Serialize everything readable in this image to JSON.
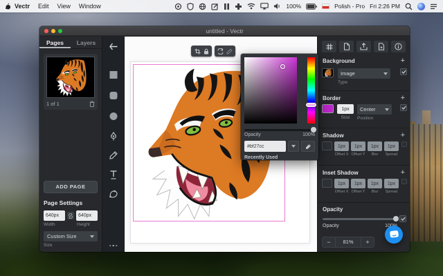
{
  "colors": {
    "accent": "#bf27cc",
    "selection": "#e879d2",
    "chat": "#1d8ff0",
    "traffic_red": "#ff5f57",
    "traffic_yellow": "#febc2e",
    "traffic_green": "#28c840"
  },
  "menubar": {
    "menus": [
      "Vectr",
      "Edit",
      "View",
      "Window"
    ],
    "battery": "100%",
    "input_source": "Polish - Pro",
    "clock": "Fri 2:26 PM",
    "status_icon_names": [
      "app-swirl-icon",
      "shield-icon",
      "globe-icon",
      "compose-icon",
      "columns-icon",
      "plus-icon",
      "wifi-icon",
      "airplay-icon",
      "volume-icon",
      "battery-icon",
      "input-flag-icon",
      "spotlight-icon",
      "siri-icon",
      "notification-center-icon"
    ]
  },
  "window": {
    "title": "untitled - Vectr"
  },
  "sidebar": {
    "tab_pages": "Pages",
    "tab_layers": "Layers",
    "page_indicator": "1 of 1",
    "add_page": "ADD PAGE",
    "settings_title": "Page Settings",
    "width_value": "640px",
    "width_label": "Width",
    "height_value": "640px",
    "height_label": "Height",
    "size_value": "Custom Size",
    "size_label": "Size"
  },
  "tools": [
    "back",
    "rectangle",
    "rounded-rectangle",
    "ellipse",
    "pen",
    "pencil",
    "text",
    "shape",
    "more"
  ],
  "picker": {
    "opacity_label": "Opacity",
    "opacity_value": "100%",
    "hex_value": "#bf27cc",
    "recently_used": "Recently Used"
  },
  "inspector": {
    "top_icon_names": [
      "grid-icon",
      "duplicate-icon",
      "export-icon",
      "import-icon",
      "info-icon"
    ],
    "add_symbol": "+",
    "background_title": "Background",
    "background_type_value": "Image",
    "background_type_label": "Type",
    "border_title": "Border",
    "border_size_value": "1px",
    "border_size_label": "Size",
    "border_position_value": "Center",
    "border_position_label": "Position",
    "shadow_title": "Shadow",
    "shadow_fields": [
      {
        "value": "1px",
        "label": "Offset X"
      },
      {
        "value": "1px",
        "label": "Offset Y"
      },
      {
        "value": "1px",
        "label": "Blur"
      },
      {
        "value": "1px",
        "label": "Spread"
      }
    ],
    "inset_title": "Inset Shadow",
    "inset_fields": [
      {
        "value": "1px",
        "label": "Offset X"
      },
      {
        "value": "1px",
        "label": "Offset Y"
      },
      {
        "value": "1px",
        "label": "Blur"
      },
      {
        "value": "1px",
        "label": "Spread"
      }
    ],
    "opacity_title": "Opacity",
    "opacity_label": "Opacity",
    "opacity_value": "100%"
  },
  "zoom_control": {
    "minus": "−",
    "value": "81%",
    "plus": "+"
  }
}
